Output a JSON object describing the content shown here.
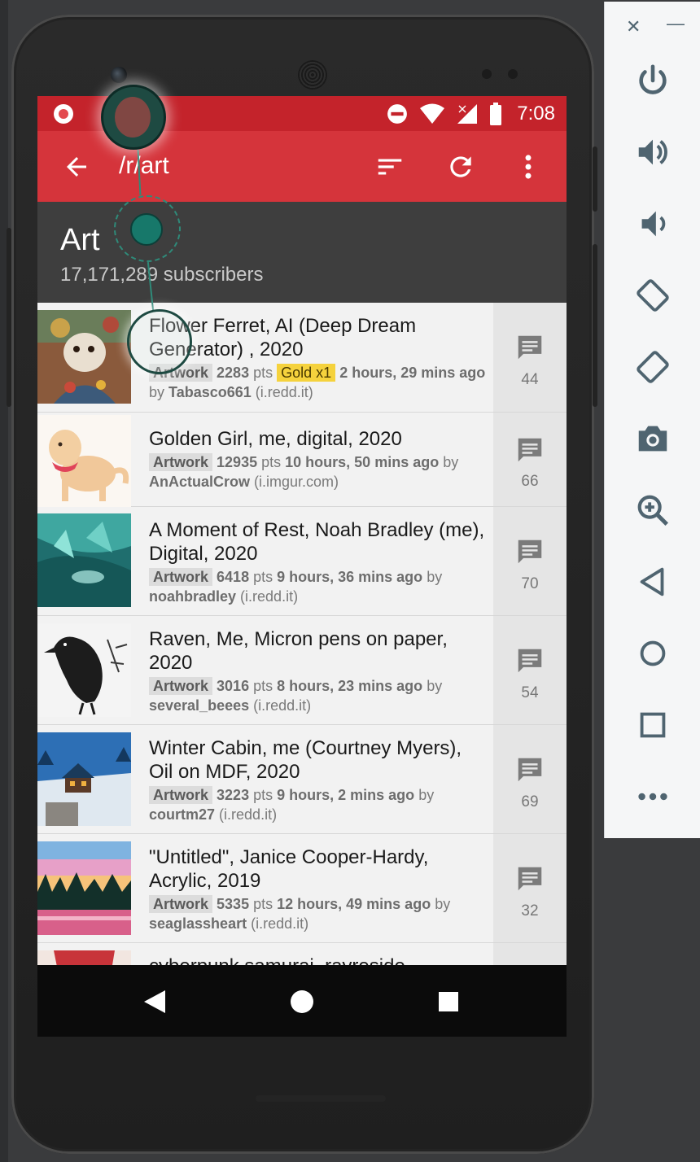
{
  "status_bar": {
    "time": "7:08"
  },
  "app_bar": {
    "title": "/r/art"
  },
  "subreddit": {
    "name": "Art",
    "subscribers": "17,171,289 subscribers"
  },
  "posts": [
    {
      "title": "Flower Ferret, AI (Deep Dream Generator) , 2020",
      "flair": "Artwork",
      "points": "2283",
      "pts_label": "pts",
      "gold": "Gold x1",
      "time": "2 hours, 29 mins ago",
      "by_label": "by",
      "author": "Tabasco661",
      "domain": "(i.redd.it)",
      "comments": "44"
    },
    {
      "title": "Golden Girl, me, digital, 2020",
      "flair": "Artwork",
      "points": "12935",
      "pts_label": "pts",
      "gold": "",
      "time": "10 hours, 50 mins ago",
      "by_label": "by",
      "author": "AnActualCrow",
      "domain": "(i.imgur.com)",
      "comments": "66"
    },
    {
      "title": "A Moment of Rest, Noah Bradley (me), Digital, 2020",
      "flair": "Artwork",
      "points": "6418",
      "pts_label": "pts",
      "gold": "",
      "time": "9 hours, 36 mins ago",
      "by_label": "by",
      "author": "noahbradley",
      "domain": "(i.redd.it)",
      "comments": "70"
    },
    {
      "title": "Raven, Me, Micron pens on paper, 2020",
      "flair": "Artwork",
      "points": "3016",
      "pts_label": "pts",
      "gold": "",
      "time": "8 hours, 23 mins ago",
      "by_label": "by",
      "author": "several_beees",
      "domain": "(i.redd.it)",
      "comments": "54"
    },
    {
      "title": "Winter Cabin, me (Courtney Myers), Oil on MDF, 2020",
      "flair": "Artwork",
      "points": "3223",
      "pts_label": "pts",
      "gold": "",
      "time": "9 hours, 2 mins ago",
      "by_label": "by",
      "author": "courtm27",
      "domain": "(i.redd.it)",
      "comments": "69"
    },
    {
      "title": "\"Untitled\", Janice Cooper-Hardy, Acrylic, 2019",
      "flair": "Artwork",
      "points": "5335",
      "pts_label": "pts",
      "gold": "",
      "time": "12 hours, 49 mins ago",
      "by_label": "by",
      "author": "seaglassheart",
      "domain": "(i.redd.it)",
      "comments": "32"
    },
    {
      "title": "cyberpunk samurai, rayreside",
      "flair": "",
      "points": "",
      "pts_label": "",
      "gold": "",
      "time": "",
      "by_label": "",
      "author": "",
      "domain": "",
      "comments": ""
    }
  ],
  "colors": {
    "status_bar": "#c4232b",
    "app_bar": "#d5343b",
    "subreddit_header": "#3e3e3e",
    "gold_badge": "#f5d23d",
    "touch_indicator": "#17786a"
  },
  "icons": {
    "back": "arrow-left-icon",
    "sort": "sort-icon",
    "refresh": "refresh-icon",
    "overflow": "more-vert-icon",
    "comments": "comment-icon",
    "emulator_tools": [
      "close-icon",
      "minimize-icon",
      "power-icon",
      "volume-up-icon",
      "volume-down-icon",
      "rotate-left-icon",
      "rotate-right-icon",
      "camera-icon",
      "zoom-icon",
      "back-triangle-icon",
      "home-circle-icon",
      "overview-square-icon",
      "more-horiz-icon"
    ]
  }
}
